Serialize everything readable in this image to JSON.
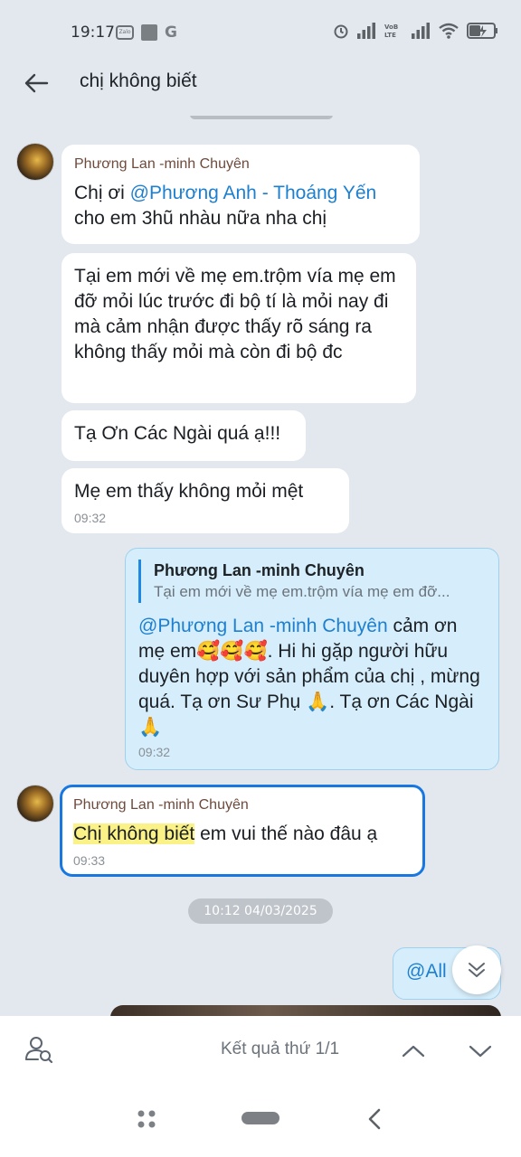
{
  "status_bar": {
    "time": "19:17",
    "left_icons": [
      "zalo-icon",
      "image-square-icon",
      "google-icon"
    ],
    "right_icons": [
      "alarm-icon",
      "signal-icon",
      "volte-lte-icon",
      "signal-2-icon",
      "wifi-icon",
      "battery-charging-icon"
    ],
    "zalo_text": "Zalo",
    "g_text": "G",
    "volte_text": "VoB LTE",
    "battery_text": "43"
  },
  "header": {
    "search_query": "chị không biết"
  },
  "messages": {
    "m1": {
      "sender": "Phương Lan -minh Chuyên",
      "text_before": "Chị ơi  ",
      "mention": "@Phương Anh - Thoáng Yến",
      "text_after": " cho em 3hũ nhàu nữa nha chị"
    },
    "m2": {
      "text": "Tại em mới về mẹ em.trộm vía mẹ em đỡ mỏi lúc trước đi bộ tí là mỏi nay đi mà cảm nhận được thấy rõ sáng ra không thấy mỏi mà còn đi bộ đc"
    },
    "m3": {
      "text": "Tạ Ơn Các Ngài quá ạ!!!"
    },
    "m4": {
      "text": "Mẹ em thấy không mỏi mệt",
      "time": "09:32"
    },
    "m5": {
      "quote_sender": "Phương Lan -minh Chuyên",
      "quote_snippet": "Tại em mới về mẹ em.trộm vía mẹ em đỡ...",
      "mention": "@Phương Lan -minh Chuyên",
      "text": " cảm ơn mẹ em🥰🥰🥰. Hi hi gặp người hữu duyên hợp với sản phẩm của chị , mừng quá. Tạ ơn Sư Phụ 🙏. Tạ ơn Các Ngài 🙏",
      "time": "09:32"
    },
    "m6": {
      "sender": "Phương Lan -minh Chuyên",
      "highlight": "Chị không biết",
      "text": " em vui thế nào đâu ạ",
      "time": "09:33"
    },
    "date_separator": "10:12 04/03/2025",
    "m7": {
      "text": "@All"
    }
  },
  "search_results": {
    "count_text": "Kết quả thứ 1/1"
  },
  "icons": {
    "back": "arrow-left-icon",
    "search_member": "search-person-icon",
    "prev": "chevron-up-icon",
    "next": "chevron-down-icon",
    "scroll_down": "double-chevron-down-icon"
  },
  "colors": {
    "background": "#e3e8ef",
    "mention": "#1d7fcf",
    "sent_bubble": "#d6eefb",
    "selected_border": "#1877e0",
    "highlight": "#fbf287"
  }
}
